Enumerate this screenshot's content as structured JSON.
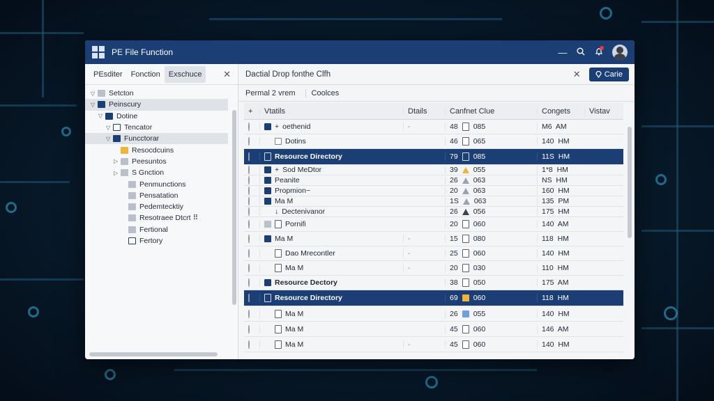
{
  "window": {
    "title": "PE File Function"
  },
  "titlebar": {
    "minimize_icon": "minus-icon",
    "search_icon": "search-icon",
    "bell_icon": "bell-icon"
  },
  "left_panel": {
    "tabs": [
      "PEsditer",
      "Fonction",
      "Exschuce"
    ],
    "active_tab": 2,
    "tree": [
      {
        "label": "Setcton",
        "depth": 0,
        "arrow": "▽",
        "icon": "folder-g"
      },
      {
        "label": "Peinscury",
        "depth": 0,
        "arrow": "▽",
        "icon": "folder-b",
        "selected": true
      },
      {
        "label": "Dotine",
        "depth": 1,
        "arrow": "▽",
        "icon": "folder-b"
      },
      {
        "label": "Tencator",
        "depth": 2,
        "arrow": "▽",
        "icon": "file-b"
      },
      {
        "label": "Funcctorar",
        "depth": 2,
        "arrow": "▽",
        "icon": "folder-b",
        "selected": true
      },
      {
        "label": "Resocdcuins",
        "depth": 3,
        "arrow": "",
        "icon": "folder-y"
      },
      {
        "label": "Peesuntos",
        "depth": 3,
        "arrow": "▷",
        "icon": "folder-g"
      },
      {
        "label": "S Gnction",
        "depth": 3,
        "arrow": "▷",
        "icon": "folder-g"
      },
      {
        "label": "Penmunctions",
        "depth": 4,
        "arrow": "",
        "icon": "folder-g"
      },
      {
        "label": "Pensatation",
        "depth": 4,
        "arrow": "",
        "icon": "folder-g"
      },
      {
        "label": "Pedemtecktiy",
        "depth": 4,
        "arrow": "",
        "icon": "folder-g"
      },
      {
        "label": "Resotraee Dtcrt ⠿",
        "depth": 4,
        "arrow": "",
        "icon": "folder-g"
      },
      {
        "label": "Fertional",
        "depth": 4,
        "arrow": "",
        "icon": "folder-g"
      },
      {
        "label": "Fertory",
        "depth": 4,
        "arrow": "",
        "icon": "file-b"
      }
    ]
  },
  "main_panel": {
    "title": "Dactial Drop fonthe Clfh",
    "close_icon": "close-icon",
    "action_button": "Carie",
    "subtabs": [
      "Permal 2 vrem",
      "Coolces"
    ],
    "columns": [
      "+",
      "Vtatils",
      "Dtails",
      "Canfnet Clue",
      "Congets",
      "Vistav"
    ],
    "rows": [
      {
        "h": 21,
        "icon": "navy",
        "prefix": "+",
        "name": "oethenid",
        "details": "-",
        "num": "48",
        "st": "doc",
        "code": "085",
        "time": "M6  AM"
      },
      {
        "h": 21,
        "icon": "none",
        "prefix": "",
        "name": "Dotins",
        "details": "",
        "num": "46",
        "st": "doc",
        "code": "065",
        "time": "140  HM",
        "nameIcon": "outline"
      },
      {
        "h": 23,
        "icon": "sel",
        "prefix": "",
        "name": "Resource Directory",
        "details": "",
        "num": "79",
        "st": "doc",
        "code": "085",
        "time": "11S  HM",
        "selected": true
      },
      {
        "h": 15,
        "icon": "navy",
        "prefix": "+",
        "name": "Sod MeDtor",
        "details": "",
        "num": "39",
        "st": "warn",
        "code": "055",
        "time": "1*8  HM"
      },
      {
        "h": 15,
        "icon": "navy",
        "prefix": "",
        "name": "Peanite",
        "details": "",
        "num": "26",
        "st": "warn-g",
        "code": "063",
        "time": "NS  HM"
      },
      {
        "h": 15,
        "icon": "navy",
        "prefix": "",
        "name": "Propmion~",
        "details": "",
        "num": "20",
        "st": "warn-g",
        "code": "063",
        "time": "160  HM"
      },
      {
        "h": 15,
        "icon": "navy",
        "prefix": "",
        "name": "Ma M",
        "details": "",
        "num": "1S",
        "st": "warn-g",
        "code": "063",
        "time": "135  PM"
      },
      {
        "h": 15,
        "icon": "none",
        "prefix": "↓",
        "name": "Dectenivanor",
        "details": "",
        "num": "26",
        "st": "warn-dark",
        "code": "056",
        "time": "175  HM"
      },
      {
        "h": 21,
        "icon": "gray",
        "prefix": "",
        "name": "Pornifi",
        "details": "",
        "num": "20",
        "st": "doc",
        "code": "060",
        "time": "140  AM",
        "nameIcon": "doc"
      },
      {
        "h": 21,
        "icon": "navy",
        "prefix": "",
        "name": "Ma M",
        "details": "-",
        "num": "15",
        "st": "doc",
        "code": "080",
        "time": "118  HM"
      },
      {
        "h": 21,
        "icon": "none",
        "prefix": "",
        "name": "Dao Mrecontler",
        "details": "-",
        "num": "25",
        "st": "doc",
        "code": "060",
        "time": "140  HM",
        "nameIcon": "doc"
      },
      {
        "h": 21,
        "icon": "none",
        "prefix": "",
        "name": "Ma M",
        "details": "-",
        "num": "20",
        "st": "doc",
        "code": "030",
        "time": "110  HM",
        "nameIcon": "doc"
      },
      {
        "h": 21,
        "icon": "navy",
        "prefix": "",
        "name": "Resource Dectory",
        "details": "",
        "num": "38",
        "st": "doc",
        "code": "050",
        "time": "175  AM",
        "bold": true
      },
      {
        "h": 23,
        "icon": "sel",
        "prefix": "",
        "name": "Resource Directory",
        "details": "",
        "num": "69",
        "st": "amber",
        "code": "060",
        "time": "118  HM",
        "selected": true
      },
      {
        "h": 22,
        "icon": "none",
        "prefix": "",
        "name": "Ma M",
        "details": "",
        "num": "26",
        "st": "blue",
        "code": "055",
        "time": "140  HM",
        "nameIcon": "doc"
      },
      {
        "h": 22,
        "icon": "none",
        "prefix": "",
        "name": "Ma M",
        "details": "",
        "num": "45",
        "st": "doc",
        "code": "060",
        "time": "146  AM",
        "nameIcon": "doc"
      },
      {
        "h": 22,
        "icon": "none",
        "prefix": "",
        "name": "Ma M",
        "details": "-",
        "num": "45",
        "st": "doc",
        "code": "060",
        "time": "140  HM",
        "nameIcon": "doc"
      }
    ]
  }
}
